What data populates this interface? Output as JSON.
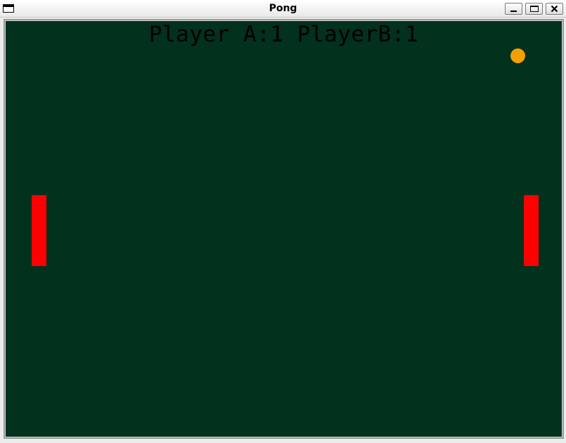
{
  "window": {
    "title": "Pong",
    "controls": {
      "minimize": "minimize",
      "maximize": "maximize",
      "close": "close"
    }
  },
  "game": {
    "score_text": "Player A:1 PlayerB:1",
    "score": {
      "player_a": 1,
      "player_b": 1
    }
  },
  "colors": {
    "court_background": "#02311e",
    "paddle": "#ff0000",
    "ball": "#f5a000",
    "score_text": "#000000"
  },
  "icons": {
    "window_menu": "window-menu-icon",
    "minimize": "minimize-icon",
    "maximize": "maximize-icon",
    "close": "close-icon"
  }
}
